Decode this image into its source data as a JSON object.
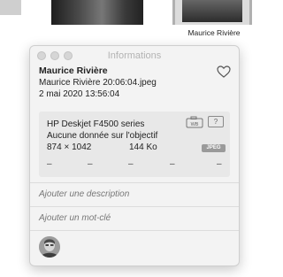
{
  "thumbnail_caption": "Maurice Rivière",
  "window": {
    "title": "Informations"
  },
  "photo": {
    "title": "Maurice Rivière",
    "file_name": "Maurice Rivière 20:06:04.jpeg",
    "date": "2 mai 2020   13:56:04"
  },
  "metadata": {
    "camera": "HP Deskjet F4500 series",
    "lens": "Aucune donnée sur l'objectif",
    "dimensions": "874 × 1042",
    "file_size": "144 Ko",
    "format_badge": "JPEG",
    "white_balance_label": "WB",
    "unknown_badge": "?",
    "exposure": [
      "–",
      "–",
      "–",
      "–",
      "–"
    ]
  },
  "fields": {
    "description_placeholder": "Ajouter une description",
    "keyword_placeholder": "Ajouter un mot-clé"
  },
  "icons": {
    "favorite": "heart-icon",
    "white_balance": "camera-wb-icon",
    "face": "face-avatar"
  }
}
